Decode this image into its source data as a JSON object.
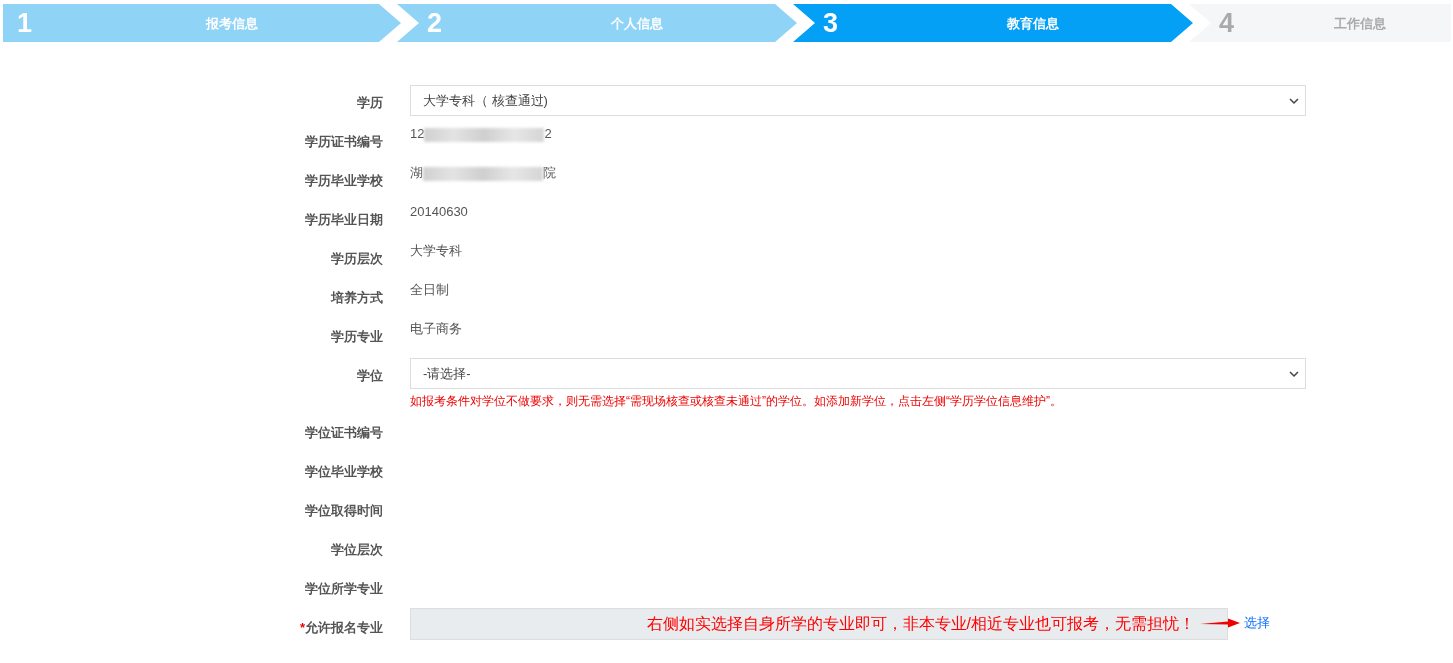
{
  "steps": [
    {
      "number": "1",
      "label": "报考信息",
      "completed": true,
      "selected": false
    },
    {
      "number": "2",
      "label": "个人信息",
      "completed": true,
      "selected": false
    },
    {
      "number": "3",
      "label": "教育信息",
      "completed": false,
      "selected": true
    },
    {
      "number": "4",
      "label": "工作信息",
      "completed": false,
      "selected": false
    }
  ],
  "fields": [
    {
      "kind": "select",
      "label": "学历",
      "value": "大学专科（ 核查通过)"
    },
    {
      "kind": "redacted",
      "label": "学历证书编号",
      "value_start": "12",
      "value_end": "2"
    },
    {
      "kind": "redacted",
      "label": "学历毕业学校",
      "value_start": "湖",
      "value_end": "院"
    },
    {
      "kind": "text",
      "label": "学历毕业日期",
      "value": "20140630"
    },
    {
      "kind": "text",
      "label": "学历层次",
      "value": "大学专科"
    },
    {
      "kind": "text",
      "label": "培养方式",
      "value": "全日制"
    },
    {
      "kind": "text",
      "label": "学历专业",
      "value": "电子商务"
    },
    {
      "kind": "select",
      "label": "学位",
      "value": "-请选择-",
      "hint": "如报考条件对学位不做要求，则无需选择“需现场核查或核查未通过”的学位。如添加新学位，点击左侧“学历学位信息维护”。"
    },
    {
      "kind": "text",
      "label": "学位证书编号"
    },
    {
      "kind": "text",
      "label": "学位毕业学校"
    },
    {
      "kind": "text",
      "label": "学位取得时间"
    },
    {
      "kind": "text",
      "label": "学位层次"
    },
    {
      "kind": "text",
      "label": "学位所学专业"
    },
    {
      "kind": "picker",
      "label": "允许报名专业",
      "required_mark": "*",
      "annotation": "右侧如实选择自身所学的专业即可，非本专业/相近专业也可报考，无需担忧！",
      "link": "选择"
    }
  ]
}
